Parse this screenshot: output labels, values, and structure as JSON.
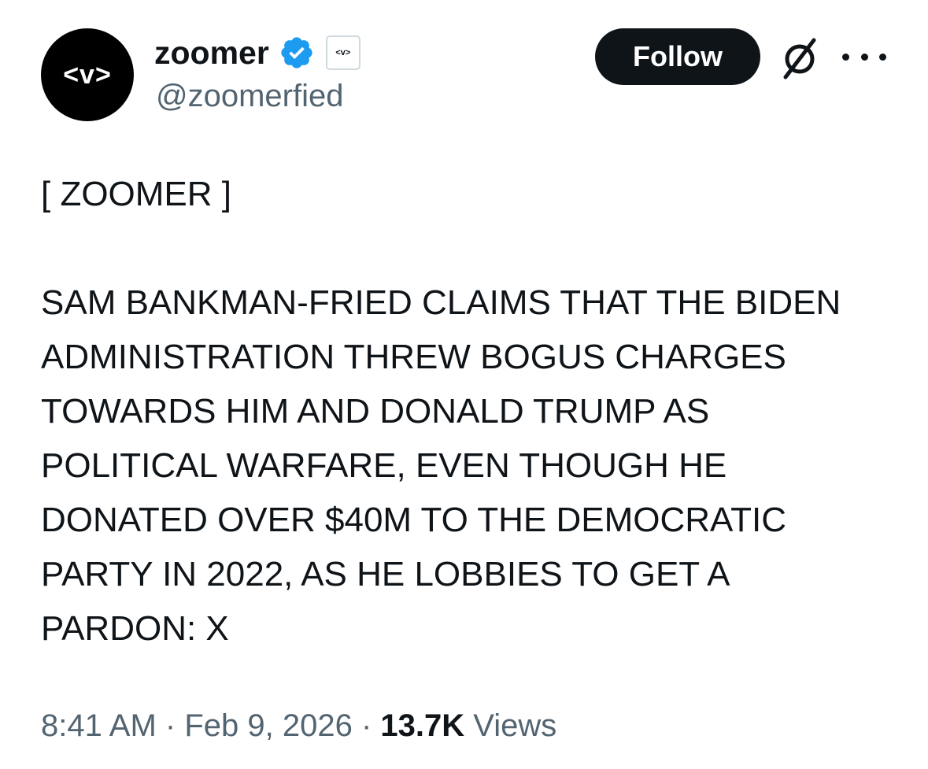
{
  "author": {
    "avatar_text": "<v>",
    "display_name": "zoomer",
    "affiliate_badge_text": "<v>",
    "handle": "@zoomerfied"
  },
  "actions": {
    "follow_label": "Follow"
  },
  "icons": {
    "verified": "verified-badge-icon",
    "grok": "grok-icon",
    "more": "more-options-icon"
  },
  "colors": {
    "verified_blue": "#1d9bf0",
    "text_primary": "#0f1419",
    "text_secondary": "#536471",
    "button_bg": "#0f1419"
  },
  "tweet": {
    "text": "[ ZOOMER ]\n\nSAM BANKMAN-FRIED CLAIMS THAT THE BIDEN ADMINISTRATION THREW BOGUS CHARGES TOWARDS HIM AND DONALD TRUMP AS POLITICAL WARFARE, EVEN THOUGH HE DONATED OVER $40M TO THE DEMOCRATIC PARTY IN 2022, AS HE LOBBIES TO GET A PARDON: X"
  },
  "meta": {
    "time": "8:41 AM",
    "separator": "·",
    "date": "Feb 9, 2026",
    "views_count": "13.7K",
    "views_label": "Views"
  }
}
